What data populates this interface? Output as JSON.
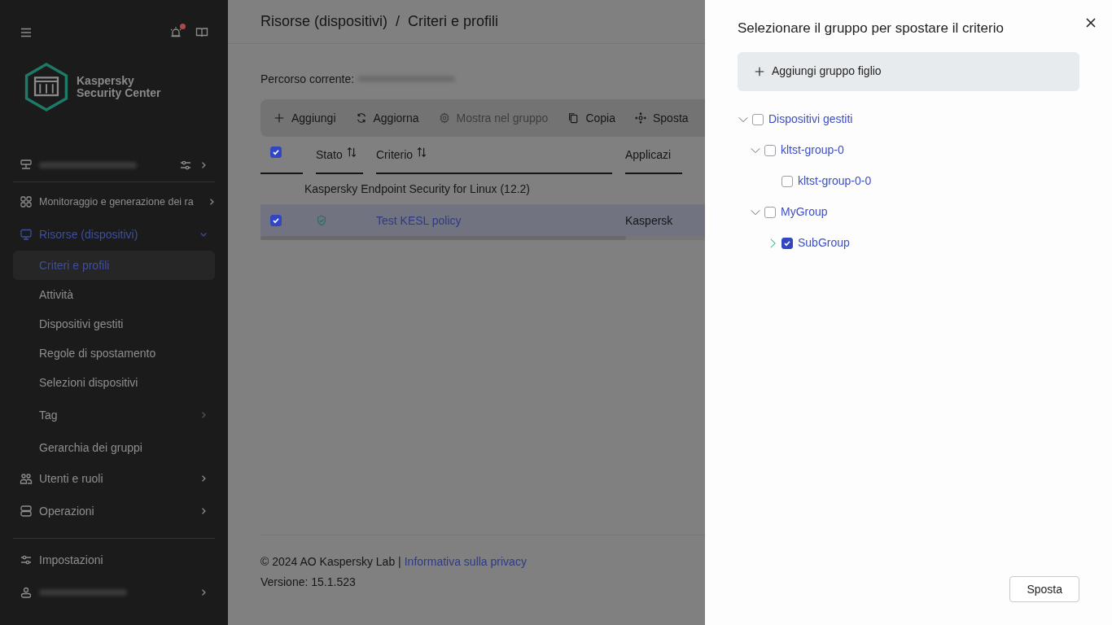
{
  "sidebar": {
    "product": {
      "line1": "Kaspersky",
      "line2": "Security Center"
    },
    "notifications": {
      "unread": true
    },
    "items": [
      {
        "label": "Monitoraggio e generazione dei ra",
        "selected": false,
        "expanded": false
      },
      {
        "label": "Risorse (dispositivi)",
        "selected": true,
        "expanded": true,
        "children": [
          {
            "label": "Criteri e profili",
            "selected": true
          },
          {
            "label": "Attività",
            "selected": false
          },
          {
            "label": "Dispositivi gestiti",
            "selected": false
          },
          {
            "label": "Regole di spostamento",
            "selected": false
          },
          {
            "label": "Selezioni dispositivi",
            "selected": false
          },
          {
            "label": "Tag",
            "selected": false,
            "has_submenu": true
          },
          {
            "label": "Gerarchia dei gruppi",
            "selected": false
          }
        ]
      },
      {
        "label": "Utenti e ruoli",
        "selected": false,
        "expanded": false
      },
      {
        "label": "Operazioni",
        "selected": false,
        "expanded": false
      }
    ],
    "settings": "Impostazioni"
  },
  "breadcrumb": [
    "Risorse (dispositivi)",
    "/",
    "Criteri e profili"
  ],
  "current_path_label": "Percorso corrente:",
  "toolbar": [
    {
      "label": "Aggiungi",
      "disabled": false
    },
    {
      "label": "Aggiorna",
      "disabled": false
    },
    {
      "label": "Mostra nel gruppo",
      "disabled": true
    },
    {
      "label": "Copia",
      "disabled": false
    },
    {
      "label": "Sposta",
      "disabled": false
    }
  ],
  "table": {
    "all_checked": true,
    "columns": [
      "Stato",
      "Criterio",
      "Applicazi"
    ],
    "group": "Kaspersky Endpoint Security for Linux (12.2)",
    "rows": [
      {
        "checked": true,
        "selected": true,
        "name": "Test KESL policy",
        "column_3": "Kaspersk"
      }
    ]
  },
  "footer": {
    "copyright": "© 2024 AO Kaspersky Lab |",
    "privacy": "Informativa sulla privacy",
    "version": "Versione: 15.1.523"
  },
  "panel": {
    "title": "Selezionare il gruppo per spostare il criterio",
    "add_button": "Aggiungi gruppo figlio",
    "tree": [
      {
        "label": "Dispositivi gestiti",
        "checked": false,
        "expanded": true,
        "children": [
          {
            "label": "kltst-group-0",
            "checked": false,
            "expanded": true,
            "children": [
              {
                "label": "kltst-group-0-0",
                "checked": false
              }
            ]
          },
          {
            "label": "MyGroup",
            "checked": false,
            "expanded": true,
            "children": [
              {
                "label": "SubGroup",
                "checked": true,
                "expanded": false
              }
            ]
          }
        ]
      }
    ],
    "submit": "Sposta"
  }
}
